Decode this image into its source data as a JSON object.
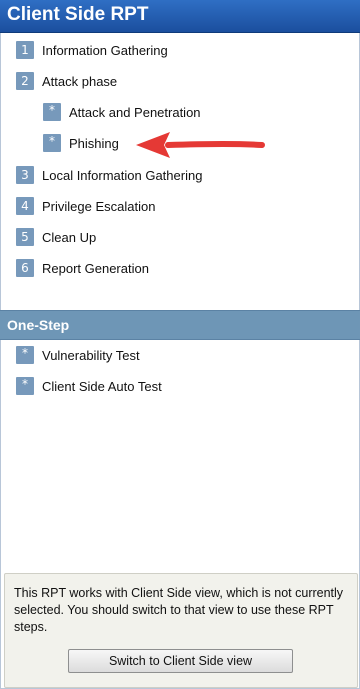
{
  "header": {
    "title": "Client Side RPT"
  },
  "steps": [
    {
      "badge": "1",
      "label": "Information Gathering"
    },
    {
      "badge": "2",
      "label": "Attack phase"
    },
    {
      "badge": "*",
      "label": "Attack and Penetration"
    },
    {
      "badge": "*",
      "label": "Phishing"
    },
    {
      "badge": "3",
      "label": "Local Information Gathering"
    },
    {
      "badge": "4",
      "label": "Privilege Escalation"
    },
    {
      "badge": "5",
      "label": "Clean Up"
    },
    {
      "badge": "6",
      "label": "Report Generation"
    }
  ],
  "one_step": {
    "title": "One-Step",
    "items": [
      {
        "badge": "*",
        "label": "Vulnerability Test"
      },
      {
        "badge": "*",
        "label": "Client Side Auto Test"
      }
    ]
  },
  "notice": {
    "text": "This RPT works with Client Side view, which is not currently selected. You should switch to that view to use these RPT steps.",
    "button_label": "Switch to Client Side view"
  },
  "colors": {
    "title_bar": "#1f5aae",
    "badge": "#7799bb",
    "section_header": "#6e96b6",
    "arrow": "#e53935"
  }
}
